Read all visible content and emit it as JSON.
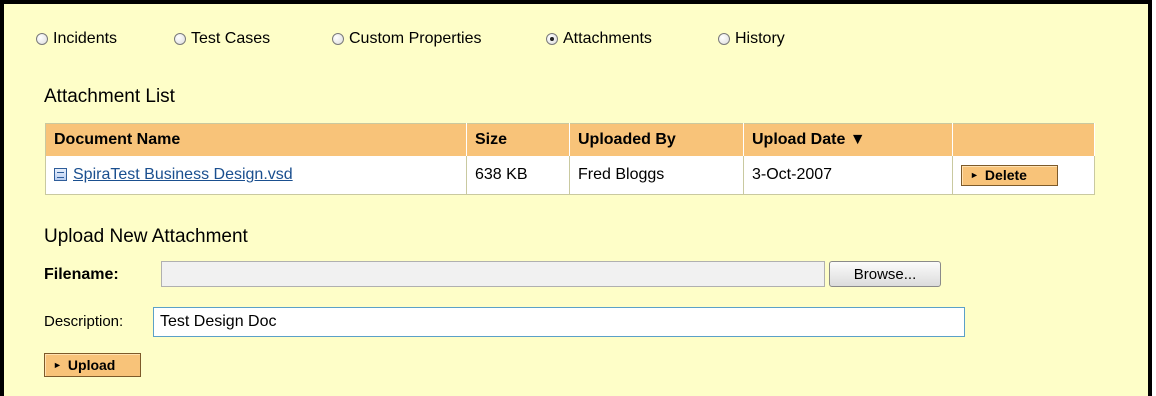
{
  "tabs": [
    {
      "label": "Incidents",
      "checked": false
    },
    {
      "label": "Test Cases",
      "checked": false
    },
    {
      "label": "Custom Properties",
      "checked": false
    },
    {
      "label": "Attachments",
      "checked": true
    },
    {
      "label": "History",
      "checked": false
    }
  ],
  "attachment_list": {
    "title": "Attachment List",
    "columns": [
      "Document Name",
      "Size",
      "Uploaded By",
      "Upload Date ▼",
      ""
    ],
    "rows": [
      {
        "document_name": "SpiraTest Business Design.vsd",
        "size": "638 KB",
        "uploaded_by": "Fred Bloggs",
        "upload_date": "3-Oct-2007",
        "action_label": "Delete"
      }
    ]
  },
  "upload": {
    "title": "Upload New Attachment",
    "filename_label": "Filename:",
    "filename_value": "",
    "browse_label": "Browse...",
    "description_label": "Description:",
    "description_value": "Test Design Doc",
    "upload_label": "Upload"
  },
  "colors": {
    "panel_background": "#fefec8",
    "header_background": "#f8c379",
    "link": "#1a4f8f"
  }
}
